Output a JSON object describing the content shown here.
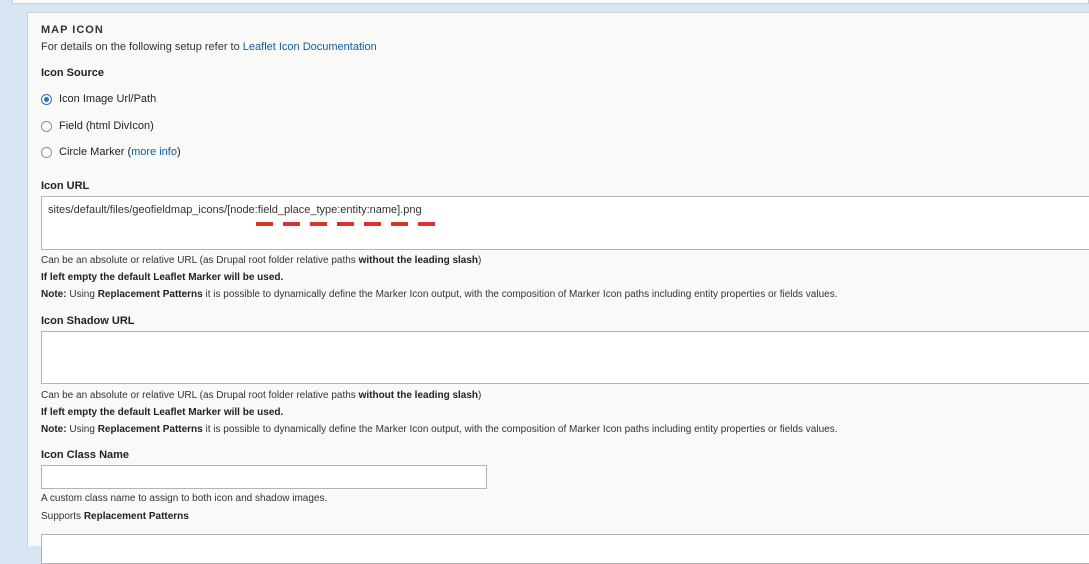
{
  "section": {
    "title": "MAP ICON",
    "intro_text": "For details on the following setup refer to ",
    "intro_link": "Leaflet Icon Documentation"
  },
  "icon_source": {
    "label": "Icon Source",
    "options": [
      {
        "label": "Icon Image Url/Path",
        "selected": true
      },
      {
        "label": "Field (html DivIcon)",
        "selected": false
      },
      {
        "label": "Circle Marker (",
        "link": "more info",
        "suffix": ")",
        "selected": false
      }
    ]
  },
  "icon_url": {
    "label": "Icon URL",
    "value": "sites/default/files/geofieldmap_icons/[node:field_place_type:entity:name].png",
    "help1_pre": "Can be an absolute or relative URL (as Drupal root folder relative paths ",
    "help1_bold": "without the leading slash",
    "help1_post": ")",
    "help2": "If left empty the default Leaflet Marker will be used.",
    "help3_note": "Note:",
    "help3_mid": " Using ",
    "help3_bold": "Replacement Patterns",
    "help3_post": " it is possible to dynamically define the Marker Icon output, with the composition of Marker Icon paths including entity properties or fields values."
  },
  "icon_shadow_url": {
    "label": "Icon Shadow URL",
    "value": "",
    "help1_pre": "Can be an absolute or relative URL (as Drupal root folder relative paths ",
    "help1_bold": "without the leading slash",
    "help1_post": ")",
    "help2": "If left empty the default Leaflet Marker will be used.",
    "help3_note": "Note:",
    "help3_mid": " Using ",
    "help3_bold": "Replacement Patterns",
    "help3_post": " it is possible to dynamically define the Marker Icon output, with the composition of Marker Icon paths including entity properties or fields values."
  },
  "icon_class_name": {
    "label": "Icon Class Name",
    "value": "",
    "help1": "A custom class name to assign to both icon and shadow images.",
    "help2_pre": "Supports ",
    "help2_bold": "Replacement Patterns"
  },
  "colors": {
    "link": "#0a5fa3",
    "radio_selected": "#2d6fc4",
    "annotation_red": "#d9342b"
  }
}
